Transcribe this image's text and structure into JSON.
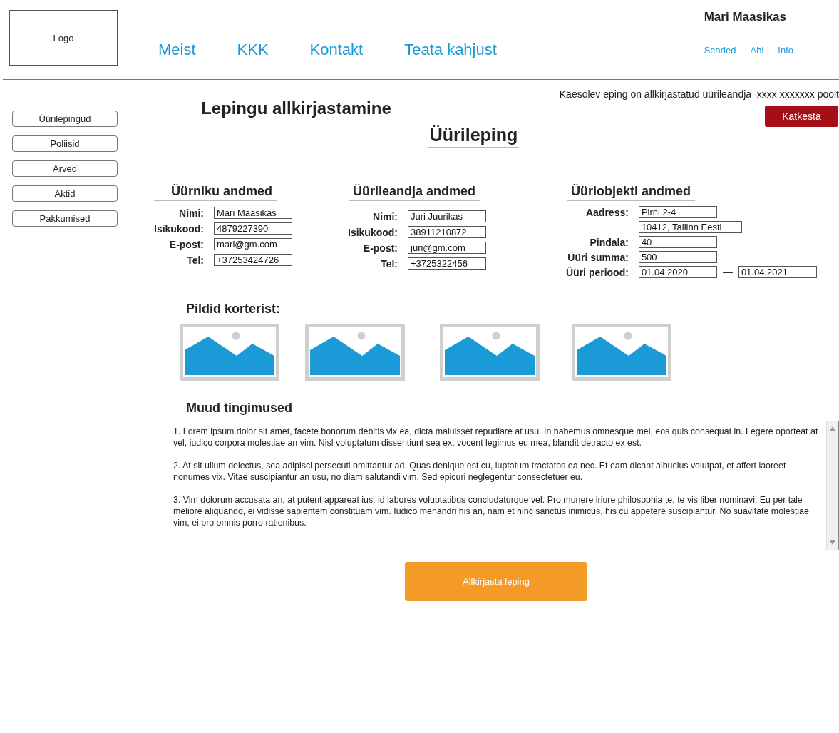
{
  "header": {
    "logo": "Logo",
    "nav": [
      "Meist",
      "KKK",
      "Kontakt",
      "Teata kahjust"
    ],
    "user": "Mari Maasikas",
    "user_links": [
      "Seaded",
      "Abi",
      "Info"
    ]
  },
  "sidebar": {
    "items": [
      "Üürilepingud",
      "Poliisid",
      "Arved",
      "Aktid",
      "Pakkumised"
    ]
  },
  "page_title": "Lepingu allkirjastamine",
  "notice": "Käesolev eping on allkirjastatud üürileandja  xxxx xxxxxxx poolt",
  "cancel_button": "Katkesta",
  "contract_title": "Üürileping",
  "sections": [
    {
      "title": "Üürniku andmed",
      "fields": [
        {
          "label": "Nimi:",
          "values": [
            "Mari Maasikas"
          ]
        },
        {
          "label": "Isikukood:",
          "values": [
            "4879227390"
          ]
        },
        {
          "label": "E-post:",
          "values": [
            "mari@gm.com"
          ]
        },
        {
          "label": "Tel:",
          "values": [
            "+37253424726"
          ]
        }
      ]
    },
    {
      "title": "Üürileandja andmed",
      "fields": [
        {
          "label": "Nimi:",
          "values": [
            "Juri Juurikas"
          ]
        },
        {
          "label": "Isikukood:",
          "values": [
            "38911210872"
          ]
        },
        {
          "label": "E-post:",
          "values": [
            "juri@gm.com"
          ]
        },
        {
          "label": "Tel:",
          "values": [
            "+3725322456"
          ]
        }
      ]
    },
    {
      "title": "Üüriobjekti andmed",
      "fields": [
        {
          "label": "Aadress:",
          "values": [
            "Pirni 2-4"
          ]
        },
        {
          "values": [
            "10412, Tallinn Eesti"
          ]
        },
        {
          "label": "Pindala:",
          "values": [
            "40"
          ]
        },
        {
          "label": "Üüri summa:",
          "values": [
            "500"
          ]
        },
        {
          "label": "Üüri periood:",
          "values": [
            "01.04.2020",
            "01.04.2021"
          ]
        }
      ]
    }
  ],
  "photos": {
    "title": "Pildid korterist:"
  },
  "terms": {
    "title": "Muud tingimused",
    "paragraphs": [
      "1. Lorem ipsum dolor sit amet, facete bonorum debitis vix ea, dicta maluisset repudiare at usu. In habemus omnesque mei, eos quis consequat in. Legere oporteat at vel, iudico corpora molestiae an vim. Nisl voluptatum dissentiunt sea ex, vocent legimus eu mea, blandit detracto ex est.",
      "2. At sit ullum delectus, sea adipisci persecuti omittantur ad. Quas denique est cu, luptatum tractatos ea nec. Et eam dicant albucius volutpat, et affert laoreet nonumes vix. Vitae suscipiantur an usu, no diam salutandi vim. Sed epicuri neglegentur consectetuer eu.",
      "3. Vim dolorum accusata an, at putent appareat ius, id labores voluptatibus concludaturque vel. Pro munere iriure philosophia te, te vis liber nominavi. Eu per tale meliore aliquando, ei vidisse sapientem constituam vim. Iudico menandri his an, nam et hinc sanctus inimicus, his cu appetere suscipiantur. No suavitate molestiae vim, ei pro omnis porro rationibus."
    ]
  },
  "sign_button": "Allkirjasta leping"
}
